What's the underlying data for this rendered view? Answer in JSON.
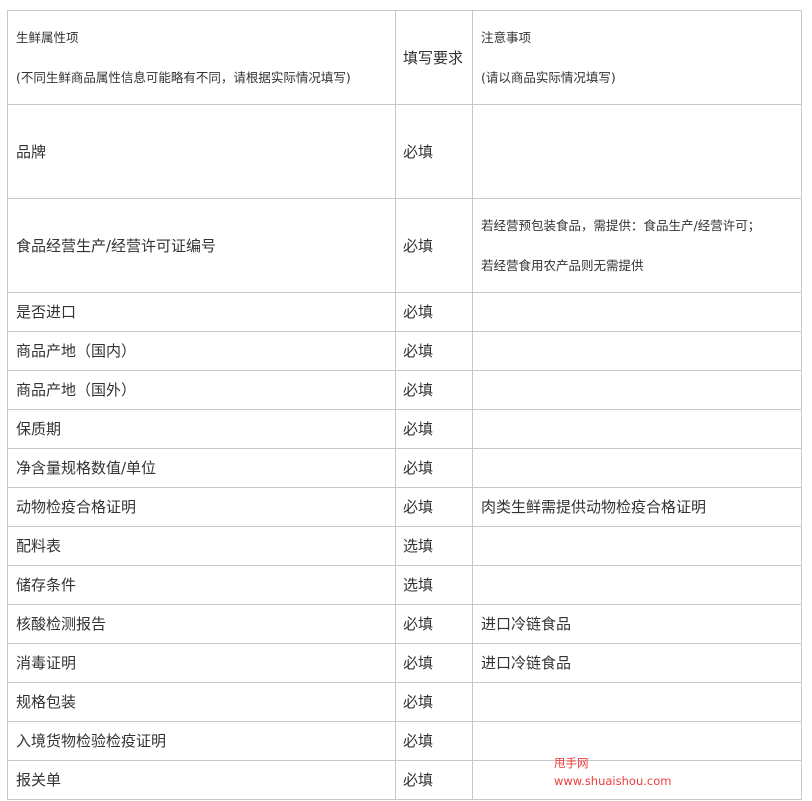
{
  "header": {
    "col1_title": "生鲜属性项",
    "col1_note": "(不同生鲜商品属性信息可能略有不同，请根据实际情况填写)",
    "col2_title": "填写要求",
    "col3_title": "注意事项",
    "col3_note": "(请以商品实际情况填写)"
  },
  "rows": [
    {
      "item": "品牌",
      "requirement": "必填",
      "note": ""
    },
    {
      "item": "食品经营生产/经营许可证编号",
      "requirement": "必填",
      "note_line1": "若经营预包装食品，需提供：食品生产/经营许可；",
      "note_line2": "若经营食用农产品则无需提供"
    },
    {
      "item": "是否进口",
      "requirement": "必填",
      "note": ""
    },
    {
      "item": "商品产地（国内）",
      "requirement": "必填",
      "note": ""
    },
    {
      "item": "商品产地（国外）",
      "requirement": "必填",
      "note": ""
    },
    {
      "item": "保质期",
      "requirement": "必填",
      "note": ""
    },
    {
      "item": "净含量规格数值/单位",
      "requirement": "必填",
      "note": ""
    },
    {
      "item": "动物检疫合格证明",
      "requirement": "必填",
      "note": "肉类生鲜需提供动物检疫合格证明"
    },
    {
      "item": "配料表",
      "requirement": "选填",
      "note": ""
    },
    {
      "item": "储存条件",
      "requirement": "选填",
      "note": ""
    },
    {
      "item": "核酸检测报告",
      "requirement": "必填",
      "note": "进口冷链食品"
    },
    {
      "item": "消毒证明",
      "requirement": "必填",
      "note": "进口冷链食品"
    },
    {
      "item": "规格包装",
      "requirement": "必填",
      "note": ""
    },
    {
      "item": "入境货物检验检疫证明",
      "requirement": "必填",
      "note": ""
    },
    {
      "item": "报关单",
      "requirement": "必填",
      "note": ""
    }
  ],
  "watermark": {
    "name": "甩手网",
    "url": "www.shuaishou.com",
    "color": "#ee3b3b"
  }
}
